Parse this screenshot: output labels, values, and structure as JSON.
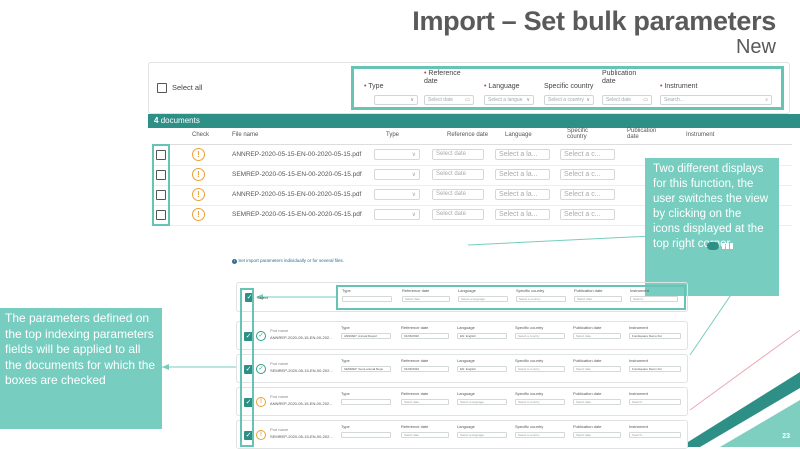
{
  "header": {
    "title": "Import – Set bulk parameters",
    "subtitle": "New"
  },
  "top": {
    "select_all": "Select all",
    "fields": {
      "type": "Type",
      "reference_date": "Reference date",
      "language": "Language",
      "specific_country": "Specific country",
      "publication_date": "Publication date",
      "instrument": "Instrument"
    },
    "placeholders": {
      "select_date": "Select date",
      "select_language": "Select a langue",
      "select_country": "Select a country",
      "search": "Search..."
    },
    "doc_count": "4",
    "doc_label": "documents",
    "columns": {
      "check": "Check",
      "file_name": "File name",
      "type": "Type",
      "reference_date": "Reference date",
      "language": "Language",
      "specific_country": "Specific country",
      "publication_date": "Publication date",
      "instrument": "Instrument"
    },
    "cell_placeholders": {
      "date": "Select date",
      "language": "Select a la...",
      "country": "Select a c..."
    },
    "rows": [
      {
        "file": "ANNREP-2020-05-15-EN-00-2020-05-15.pdf"
      },
      {
        "file": "SEMREP-2020-05-15-EN-00-2020-05-15.pdf"
      },
      {
        "file": "ANNREP-2020-05-15-EN-00-2020-05-15.pdf"
      },
      {
        "file": "SEMREP-2020-05-15-EN-00-2020-05-15.pdf"
      }
    ]
  },
  "callout_right": "Two different displays for this function, the user switches the view by clicking on the icons        displayed at the top right corner",
  "callout_left": "The parameters defined on the top indexing parameters fields will be applied to all the documents for which the boxes are checked",
  "bottom": {
    "info": "Set import parameters individually or for several files.",
    "select_label": "Select",
    "labels": {
      "type": "Type",
      "reference_date": "Reference date",
      "language": "Language",
      "specific_country": "Specific country",
      "publication_date": "Publication date",
      "instrument": "Instrument",
      "pod_name": "Pod name"
    },
    "placeholders": {
      "date": "Select date",
      "language": "Select a language",
      "country": "Select a country",
      "search": "Search..."
    },
    "rows": [
      {
        "file": "ANNREP-2020-05-15-EN-00-202...",
        "type": "ANNREP: Annual Report",
        "ref_date": "01/06/2020",
        "language": "EN: English",
        "instrument": "Fundsquare Demo Fur",
        "status": "ok"
      },
      {
        "file": "SEMREP-2020-05-15-EN-00-202...",
        "type": "SEMREP: Semi-annual Repo",
        "ref_date": "01/06/2020",
        "language": "EN: English",
        "instrument": "Fundsquare Demo Fur",
        "status": "ok"
      },
      {
        "file": "ANNREP-2020-05-15-EN-00-202...",
        "type": "",
        "ref_date": "",
        "language": "",
        "instrument": "",
        "status": "warn"
      },
      {
        "file": "SEMREP-2020-05-15-EN-00-202...",
        "type": "",
        "ref_date": "",
        "language": "",
        "instrument": "",
        "status": "warn"
      }
    ]
  },
  "page_number": "23",
  "colors": {
    "teal_dark": "#2e8f87",
    "teal_light": "#77cdbf",
    "warning": "#e8a23a",
    "required": "#d9332b"
  }
}
